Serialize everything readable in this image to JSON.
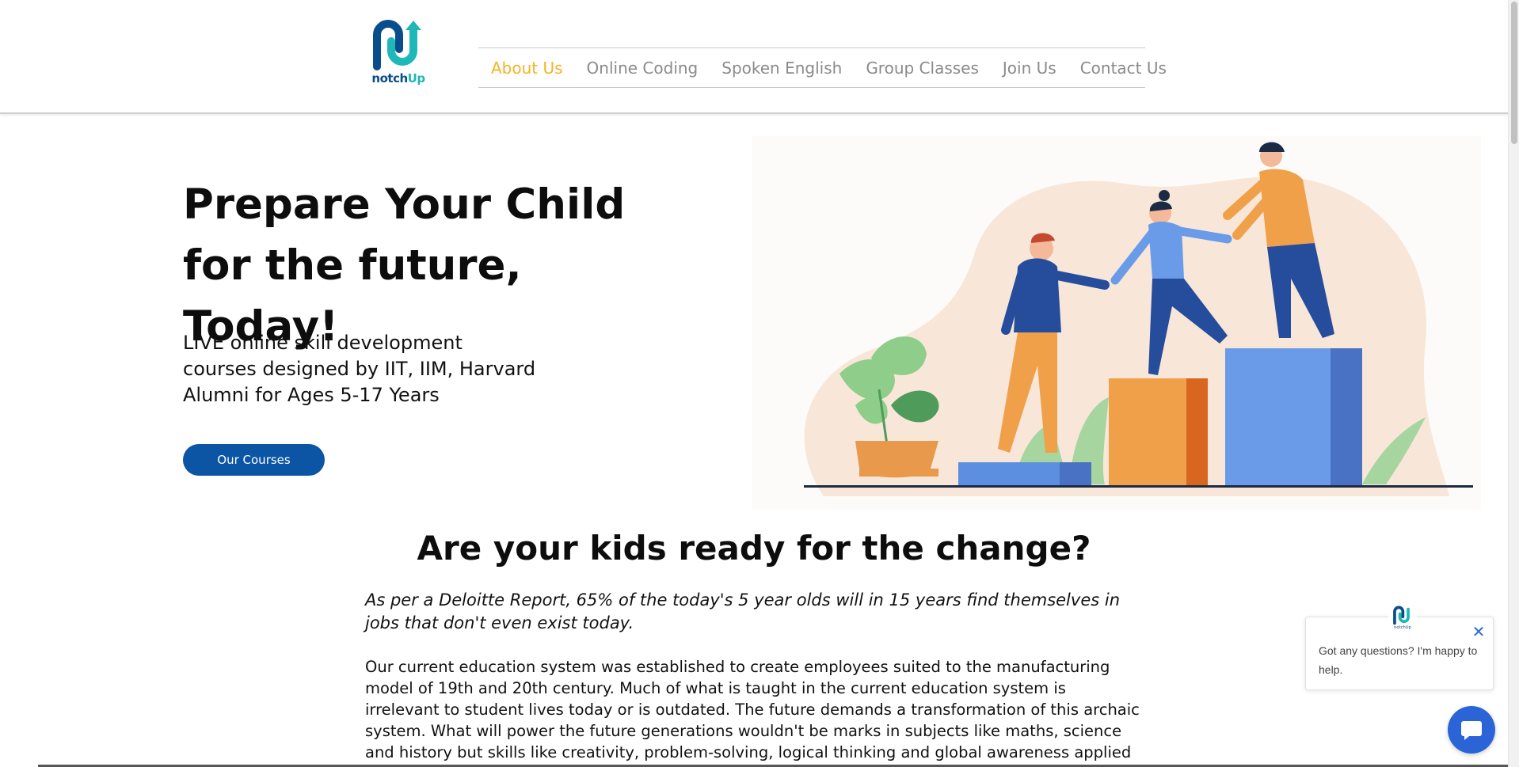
{
  "brand": {
    "name_part1": "notch",
    "name_part2": "Up",
    "primary_color": "#0b55a4",
    "accent_color": "#1fb7b7"
  },
  "nav": {
    "active_color": "#f5b324",
    "items": [
      {
        "label": "About Us",
        "active": true
      },
      {
        "label": "Online Coding"
      },
      {
        "label": "Spoken English"
      },
      {
        "label": "Group Classes"
      },
      {
        "label": "Join Us"
      },
      {
        "label": "Contact Us"
      }
    ]
  },
  "hero": {
    "title_line1": "Prepare Your Child",
    "title_line2": "for the future, Today!",
    "subtitle_line1": "LIVE online skill development",
    "subtitle_line2": "courses designed by IIT, IIM, Harvard",
    "subtitle_line3": "Alumni for Ages 5-17 Years",
    "cta_label": "Our Courses"
  },
  "section": {
    "title": "Are your kids ready for the change?",
    "quote": "As per a Deloitte Report, 65% of the today's 5 year olds will in 15 years find themselves in jobs that don't even exist today.",
    "body": "Our current education system was established to create employees suited to the manufacturing model of 19th and 20th century. Much of what is taught in the current education system is irrelevant to student lives today or is outdated. The future demands a transformation of this archaic system.  What will power the future generations wouldn't be marks in subjects like maths, science and history but skills like creativity, problem-solving, logical thinking and global awareness applied in real-world contexts."
  },
  "chat": {
    "message": "Got any questions? I'm happy to help.",
    "close_symbol": "✕",
    "avatar_brand_label": "notchUp"
  }
}
